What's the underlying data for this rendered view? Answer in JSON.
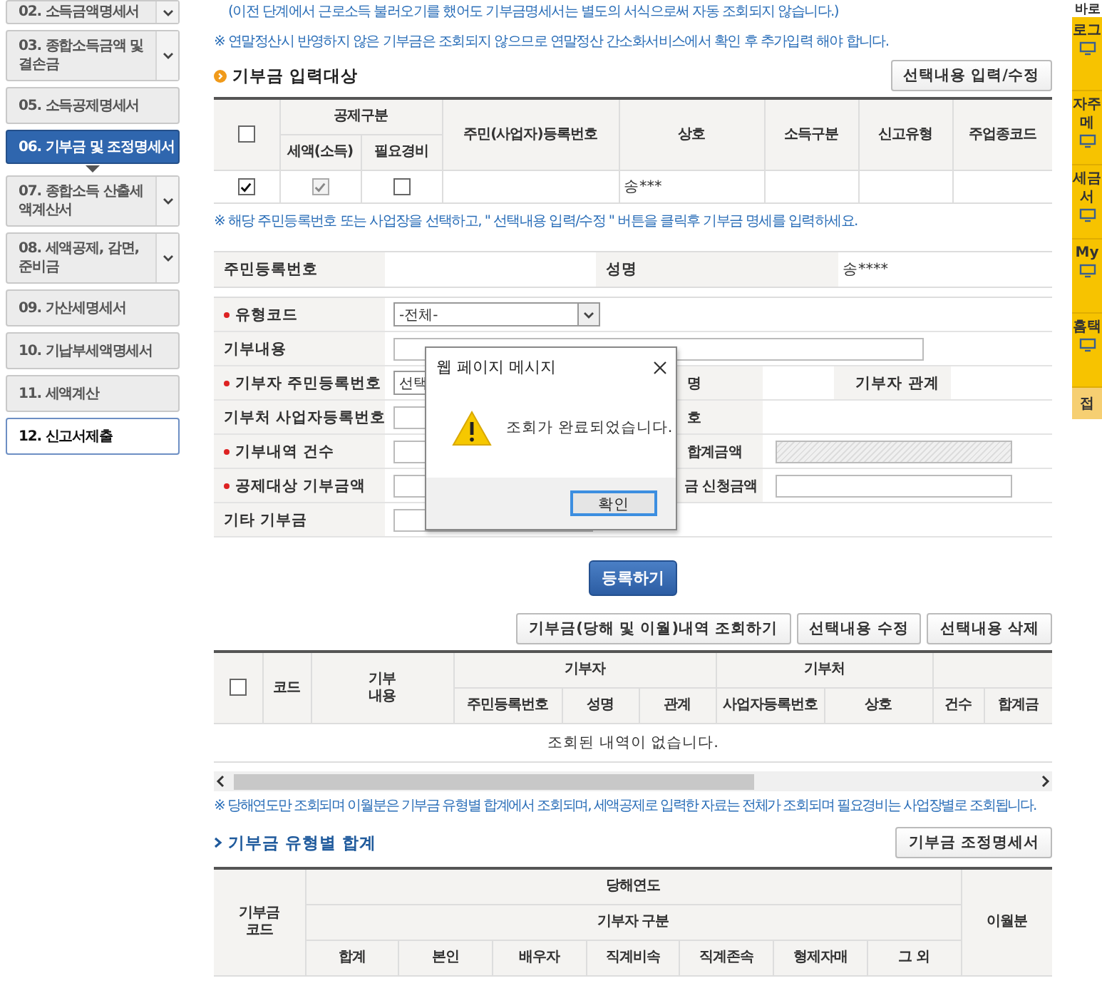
{
  "sidebar": {
    "items": [
      {
        "label": "02. 소득금액명세서",
        "selected": false,
        "expandable": true,
        "focused": false
      },
      {
        "label": "03. 종합소득금액 및 결손금",
        "selected": false,
        "expandable": true,
        "focused": false
      },
      {
        "label": "05. 소득공제명세서",
        "selected": false,
        "expandable": false,
        "focused": false
      },
      {
        "label": "06. 기부금 및 조정명세서",
        "selected": true,
        "expandable": false,
        "focused": false
      },
      {
        "label": "07. 종합소득 산출세액계산서",
        "selected": false,
        "expandable": true,
        "focused": false
      },
      {
        "label": "08. 세액공제, 감면, 준비금",
        "selected": false,
        "expandable": true,
        "focused": false
      },
      {
        "label": "09. 가산세명세서",
        "selected": false,
        "expandable": false,
        "focused": false
      },
      {
        "label": "10. 기납부세액명세서",
        "selected": false,
        "expandable": false,
        "focused": false
      },
      {
        "label": "11. 세액계산",
        "selected": false,
        "expandable": false,
        "focused": false
      },
      {
        "label": "12. 신고서제출",
        "selected": false,
        "expandable": false,
        "focused": true
      }
    ]
  },
  "notes_top": [
    "(이전 단계에서 근로소득 불러오기를 했어도 기부금명세서는 별도의 서식으로써 자동 조회되지 않습니다.)",
    "※ 연말정산시 반영하지 않은 기부금은 조회되지 않으므로 연말정산 간소화서비스에서 확인 후 추가입력 해야 합니다."
  ],
  "input_target": {
    "title": "기부금 입력대상",
    "button": "선택내용 입력/수정",
    "select_all": {
      "checked": false
    },
    "headers": {
      "deduction": "공제구분",
      "tax_credit": "세액(소득)",
      "expense": "필요경비",
      "registration_no": "주민(사업자)등록번호",
      "business_name": "상호",
      "income_type": "소득구분",
      "report_type": "신고유형",
      "industry_code": "주업종코드"
    },
    "rows": [
      {
        "checked": true,
        "tax_credit": {
          "checked": true,
          "disabled": true
        },
        "expense": {
          "checked": false,
          "disabled": false
        },
        "business_name": "송***"
      }
    ],
    "note": "※ 해당 주민등록번호 또는 사업장을 선택하고, \" 선택내용 입력/수정 \" 버튼을 클릭후 기부금 명세를 입력하세요."
  },
  "info": {
    "resident_no_label": "주민등록번호",
    "name_label": "성명",
    "name_value": "송****"
  },
  "form": {
    "type_code": {
      "label": "유형코드",
      "required": true,
      "value": "-전체-"
    },
    "content": {
      "label": "기부내용",
      "required": false
    },
    "donor_id": {
      "label": "기부자 주민등록번호",
      "required": true,
      "value": "선택",
      "name_label": "명",
      "relation_label": "기부자 관계"
    },
    "org_no": {
      "label": "기부처 사업자등록번호",
      "required": false,
      "name_label": "호"
    },
    "count": {
      "label": "기부내역 건수",
      "required": true,
      "total_label": "합계금액",
      "total_disabled": true
    },
    "amount": {
      "label": "공제대상 기부금액",
      "required": true,
      "claim_label": "금 신청금액",
      "claim_disabled": false
    },
    "other": {
      "label": "기타 기부금",
      "required": false
    }
  },
  "register_button": "등록하기",
  "list": {
    "buttons": [
      "기부금(당해 및 이월)내역 조회하기",
      "선택내용 수정",
      "선택내용 삭제"
    ],
    "select_all": {
      "checked": false
    },
    "headers": {
      "code": "코드",
      "content": "기부\n내용",
      "donor": "기부자",
      "org": "기부처",
      "resident_no": "주민등록번호",
      "name": "성명",
      "relation": "관계",
      "business_no": "사업자등록번호",
      "business_name": "상호",
      "count": "건수",
      "total": "합계금"
    },
    "empty": "조회된 내역이 없습니다."
  },
  "note_bottom": "※ 당해연도만 조회되며 이월분은 기부금 유형별 합계에서 조회되며, 세액공제로 입력한 자료는 전체가 조회되며 필요경비는 사업장별로 조회됩니다.",
  "summary": {
    "title": "기부금 유형별 합계",
    "button": "기부금 조정명세서",
    "headers": {
      "code": "기부금\n코드",
      "current_year": "당해연도",
      "donor_type": "기부자 구분",
      "carryover": "이월분"
    },
    "sub_headers": [
      "합계",
      "본인",
      "배우자",
      "직계비속",
      "직계존속",
      "형제자매",
      "그 외"
    ]
  },
  "quick_menu": {
    "title": "바로",
    "items": [
      {
        "lines": [
          "로그"
        ]
      },
      {
        "lines": [
          "자주",
          "메"
        ]
      },
      {
        "lines": [
          "세금",
          "서"
        ]
      },
      {
        "lines": [
          "My"
        ]
      },
      {
        "lines": [
          "홈택"
        ]
      }
    ],
    "footer": "접"
  },
  "dialog": {
    "title": "웹 페이지 메시지",
    "message": "조회가 완료되었습니다.",
    "ok": "확인"
  }
}
